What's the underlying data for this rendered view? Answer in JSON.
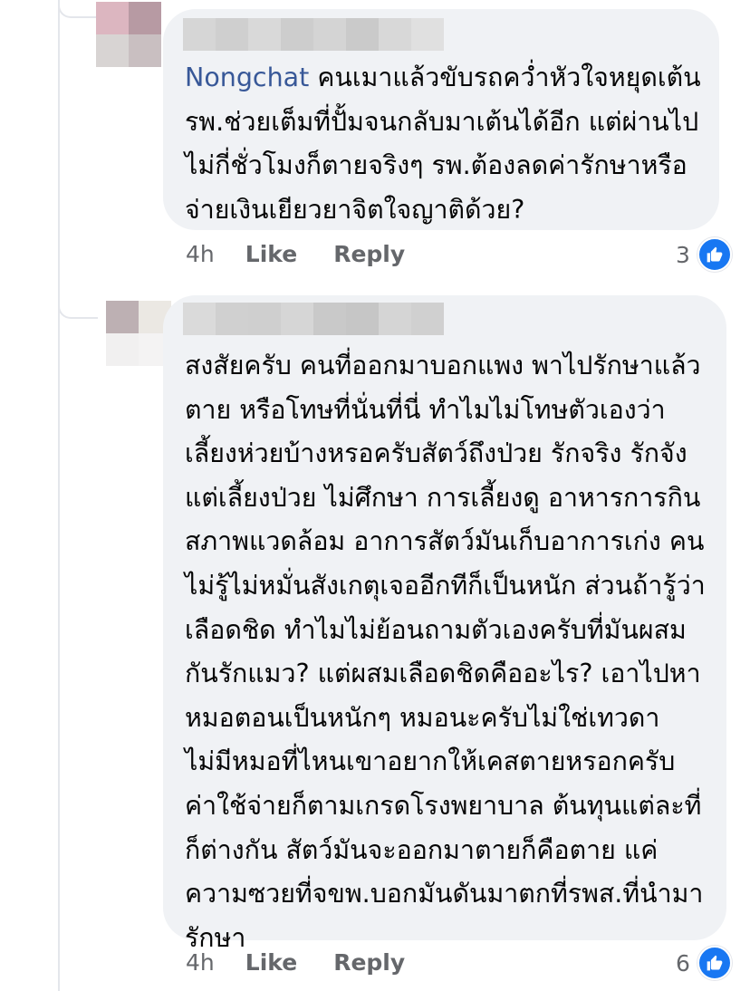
{
  "comments": [
    {
      "mention": "Nongchat",
      "text_first_line_rest": " คนเมาแล้วขับรถคว่ำหัวใจหยุดเต้น",
      "text_rest": "รพ.ช่วยเต็มที่ปั้มจนกลับมาเต้นได้อีก แต่ผ่านไป\nไม่กี่ชั่วโมงก็ตายจริงๆ รพ.ต้องลดค่ารักษาหรือ\nจ่ายเงินเยียวยาจิตใจญาติด้วย?",
      "time": "4h",
      "like_label": "Like",
      "reply_label": "Reply",
      "reaction_count": "3",
      "reaction_icon": "thumbs-up-icon"
    },
    {
      "text": "สงสัยครับ คนที่ออกมาบอกแพง พาไปรักษาแล้ว\nตาย หรือโทษที่นั่นที่นี่ ทำไมไม่โทษตัวเองว่า\nเลี้ยงห่วยบ้างหรอครับสัตว์ถึงป่วย รักจริง รักจัง\nแต่เลี้ยงป่วย ไม่ศึกษา การเลี้ยงดู อาหารการกิน\nสภาพแวดล้อม อาการสัตว์มันเก็บอาการเก่ง คน\nไม่รู้ไม่หมั่นสังเกตุเจออีกทีก็เป็นหนัก ส่วนถ้ารู้ว่า\nเลือดชิด ทำไมไม่ย้อนถามตัวเองครับที่มันผสม\nกันรักแมว? แต่ผสมเลือดชิดคืออะไร? เอาไปหา\nหมอตอนเป็นหนักๆ หมอนะครับไม่ใช่เทวดา\nไม่มีหมอที่ไหนเขาอยากให้เคสตายหรอกครับ\nค่าใช้จ่ายก็ตามเกรดโรงพยาบาล ต้นทุนแต่ละที่\nก็ต่างกัน สัตว์มันจะออกมาตายก็คือตาย แค่\nความซวยที่จขพ.บอกมันดันมาตกที่รพส.ที่นำมา\nรักษา",
      "time": "4h",
      "like_label": "Like",
      "reply_label": "Reply",
      "reaction_count": "6",
      "reaction_icon": "thumbs-up-icon"
    }
  ],
  "colors": {
    "bubble": "#f0f2f5",
    "mention": "#385898",
    "meta": "#65676b",
    "like_blue": "#1877f2"
  }
}
